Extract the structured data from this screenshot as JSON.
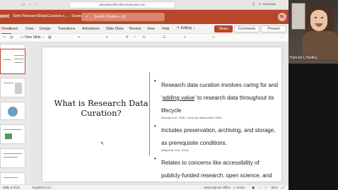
{
  "browser": {
    "url": "pennstateoffice365.sharepoint.com",
    "window_label": "Read Mac"
  },
  "office": {
    "app_name": "oint",
    "doc_title": "Seth-ResearchDataCuration.x... - Saved",
    "search_placeholder": "Search (Option + Q)",
    "avatar_initials": "HL"
  },
  "ribbon": {
    "tabs": [
      "Home",
      "Insert",
      "Draw",
      "Design",
      "Transitions",
      "Animations",
      "Slide Show",
      "Review",
      "View",
      "Help"
    ],
    "active_tab": "Home",
    "editing_label": "Editing",
    "share_label": "Share",
    "comments_label": "Comments",
    "present_label": "Present"
  },
  "toolbar": {
    "new_slide_label": "New Slide"
  },
  "slide": {
    "title": "What is Research Data Curation?",
    "bullets": [
      {
        "text_before": "Research data curation involves caring for and ‘",
        "underlined": "adding value",
        "text_after": "’ to research data throughout its lifecycle",
        "citation": "(Kanaiti et al. 2008, Lorde and Macdonald 2003)"
      },
      {
        "text": "Includes preservation, archiving, and storage, as prerequisite conditions.",
        "citation": "(Mayernik et al. 2015)"
      },
      {
        "text": "Relates to concerns like accessibility of publicly-funded research, open science, and computational reproducibility",
        "citation": ""
      }
    ]
  },
  "statusbar": {
    "slide_info": "Slide 4 of 20",
    "language": "English (U.S.)",
    "help_improve": "Help Improve Office",
    "notes": "Notes",
    "zoom": "81%"
  },
  "webcam": {
    "participant_name": "Hannah L Hadley"
  },
  "colors": {
    "brand": "#b7472a",
    "ribbon_bg": "#f3f2f1"
  }
}
